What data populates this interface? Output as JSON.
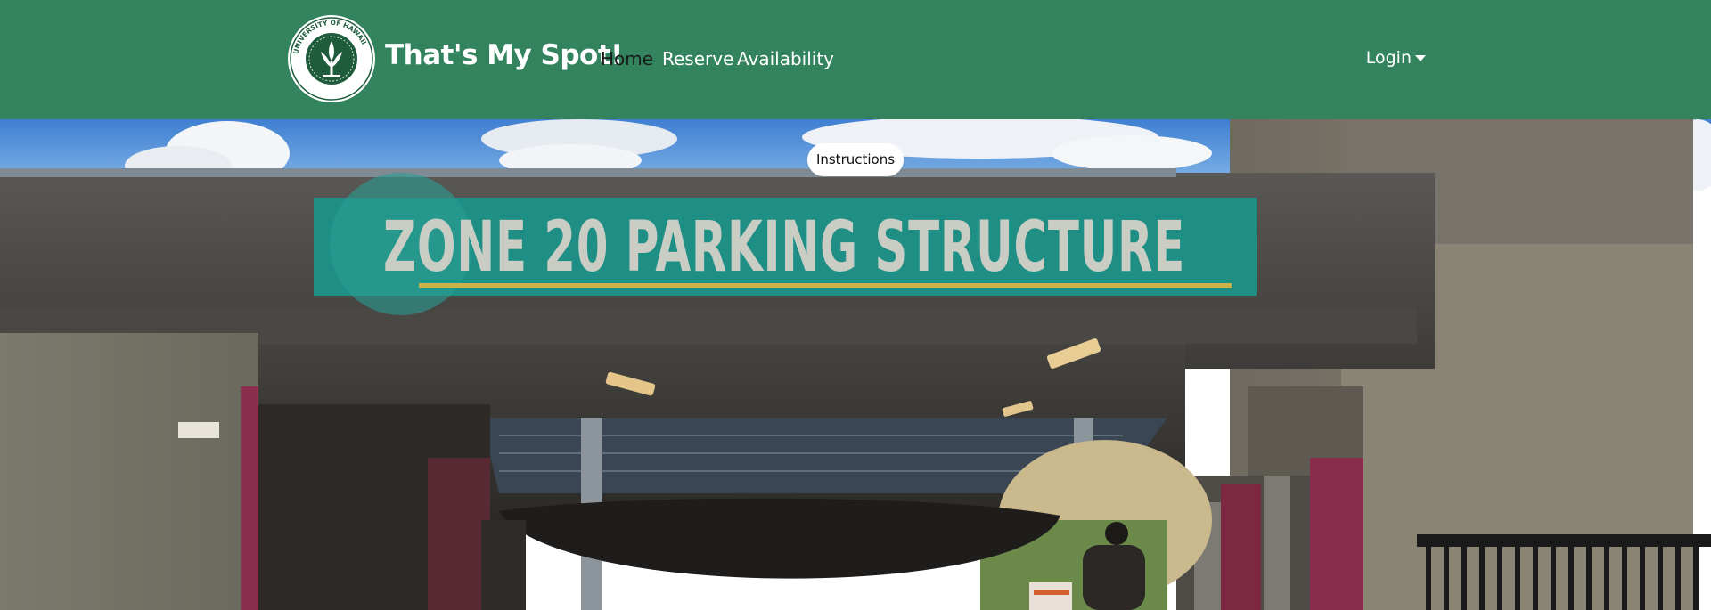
{
  "navbar": {
    "background_color": "#33835f",
    "logo": {
      "icon": "university-of-hawaii-seal-icon",
      "ring_text": "UNIVERSITY OF HAWAII"
    },
    "brand": "That's My Spot!",
    "links": [
      {
        "label": "Home",
        "active": true
      },
      {
        "label": "Reserve",
        "active": false
      },
      {
        "label": "Availability",
        "active": false
      }
    ],
    "login": {
      "label": "Login",
      "icon": "caret-down-icon"
    }
  },
  "hero": {
    "description": "photo",
    "sign_text": "ZONE 20 PARKING STRUCTURE",
    "instructions_button": "Instructions"
  }
}
